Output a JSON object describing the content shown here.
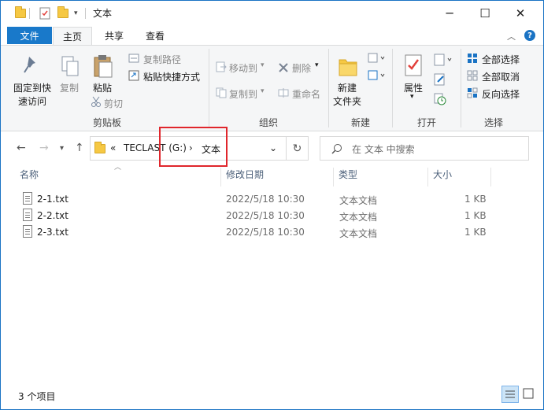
{
  "title": "文本",
  "window_controls": {
    "minimize": "─",
    "maximize": "☐",
    "close": "✕"
  },
  "ribbon_tabs": {
    "file": "文件",
    "home": "主页",
    "share": "共享",
    "view": "查看"
  },
  "ribbon": {
    "clipboard": {
      "pin_quick_access": [
        "固定到快",
        "速访问"
      ],
      "copy": "复制",
      "paste": "粘贴",
      "copy_path": "复制路径",
      "paste_shortcut": "粘贴快捷方式",
      "cut": "剪切",
      "group_label": "剪贴板"
    },
    "organize": {
      "move_to": "移动到",
      "delete": "删除",
      "copy_to": "复制到",
      "rename": "重命名",
      "group_label": "组织"
    },
    "new": {
      "new_folder": [
        "新建",
        "文件夹"
      ],
      "group_label": "新建"
    },
    "open": {
      "properties": "属性",
      "group_label": "打开"
    },
    "select": {
      "select_all": "全部选择",
      "select_none": "全部取消",
      "invert_selection": "反向选择",
      "group_label": "选择"
    }
  },
  "address": {
    "overflow": "«",
    "segments": [
      "TECLAST (G:)",
      "文本"
    ],
    "separator": "›"
  },
  "search": {
    "placeholder": "在 文本 中搜索"
  },
  "columns": {
    "name": "名称",
    "modified": "修改日期",
    "type": "类型",
    "size": "大小"
  },
  "files": [
    {
      "name": "2-1.txt",
      "modified": "2022/5/18 10:30",
      "type": "文本文档",
      "size": "1 KB"
    },
    {
      "name": "2-2.txt",
      "modified": "2022/5/18 10:30",
      "type": "文本文档",
      "size": "1 KB"
    },
    {
      "name": "2-3.txt",
      "modified": "2022/5/18 10:30",
      "type": "文本文档",
      "size": "1 KB"
    }
  ],
  "status": {
    "item_count": "3 个项目"
  },
  "colors": {
    "accent": "#1979ca",
    "highlight_box": "#e0262c",
    "folder": "#f6c843"
  }
}
